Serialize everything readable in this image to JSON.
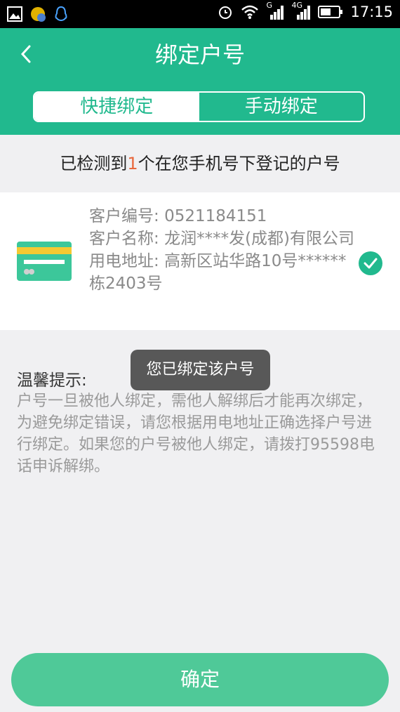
{
  "status_bar": {
    "time": "17:15",
    "network_g": "G",
    "network_4g": "4G"
  },
  "header": {
    "title": "绑定户号"
  },
  "tabs": [
    {
      "label": "快捷绑定",
      "active": true
    },
    {
      "label": "手动绑定",
      "active": false
    }
  ],
  "notice": {
    "prefix": "已检测到",
    "count": "1",
    "suffix": "个在您手机号下登记的户号"
  },
  "account": {
    "number_label": "客户编号: ",
    "number": "0521184151",
    "name_label": "客户名称: ",
    "name": "龙润****发(成都)有限公司",
    "address_label": "用电地址: ",
    "address": "高新区站华路10号******栋2403号",
    "selected": true
  },
  "tips": {
    "title": "温馨提示:",
    "body": "户号一旦被他人绑定，需他人解绑后才能再次绑定，为避免绑定错误，请您根据用电地址正确选择户号进行绑定。如果您的户号被他人绑定，请拨打95598电话申诉解绑。"
  },
  "toast": {
    "message": "您已绑定该户号"
  },
  "confirm_label": "确定",
  "colors": {
    "primary": "#21b98e",
    "button": "#4fc998",
    "highlight": "#e8683d"
  }
}
